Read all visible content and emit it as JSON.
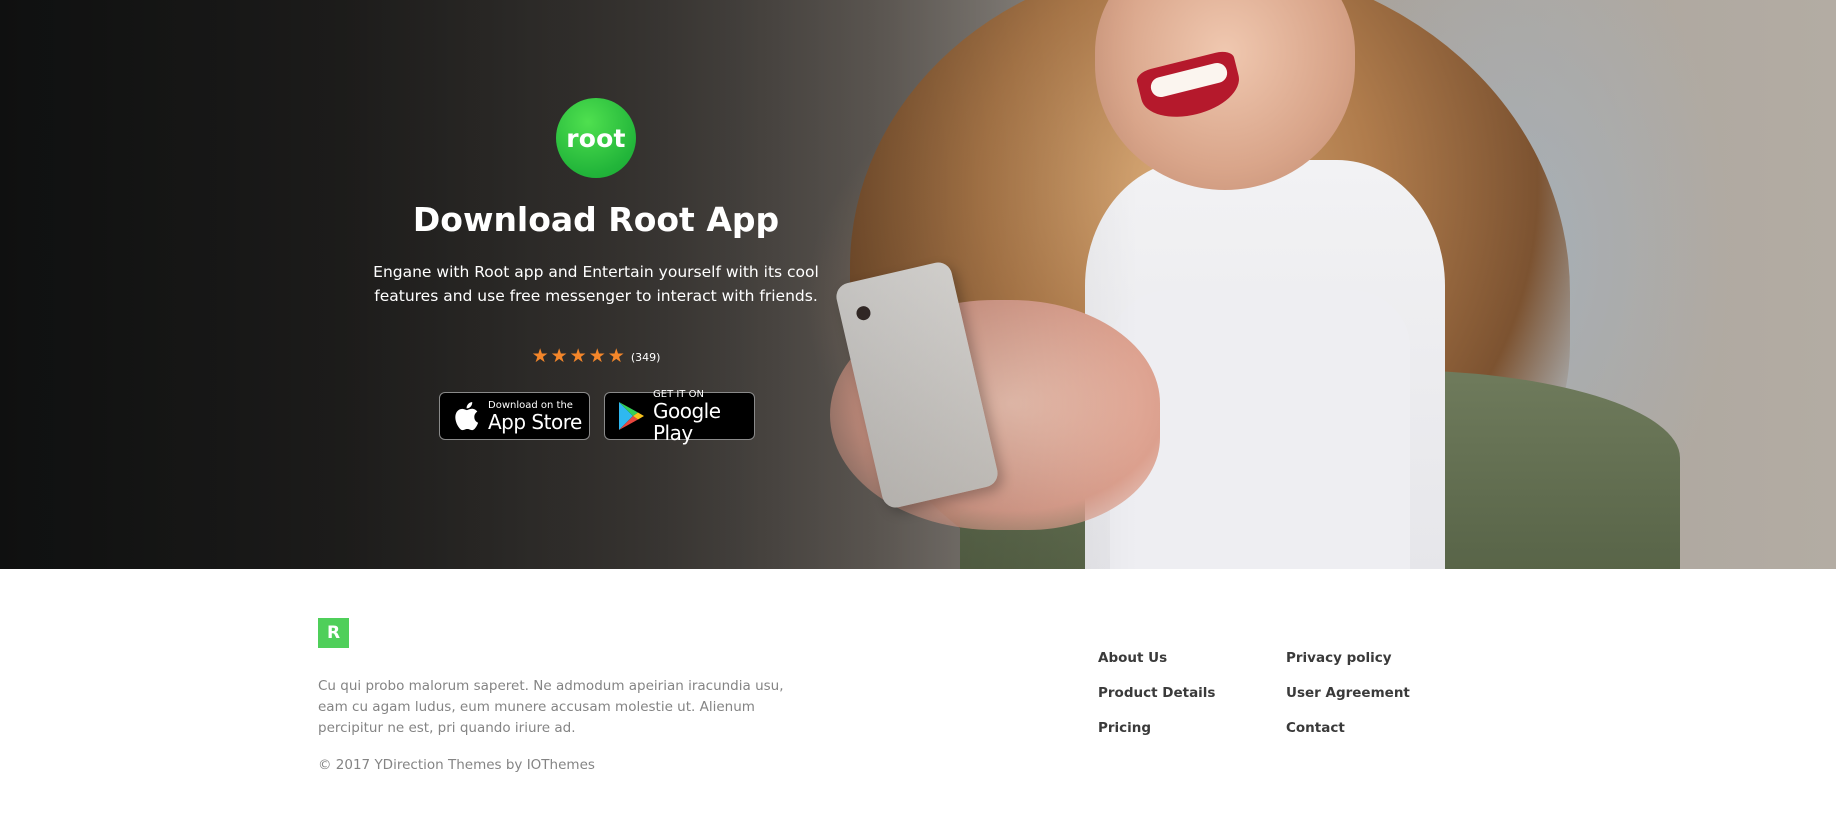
{
  "hero": {
    "logo_text": "root",
    "title": "Download Root App",
    "description": "Engane with Root app and Entertain yourself with its cool features and use free messenger to interact with friends.",
    "rating": {
      "stars": 5,
      "max_stars": 5,
      "count_label": "(349)",
      "star_color": "#f4862a"
    },
    "stores": [
      {
        "icon": "apple-icon",
        "small": "Download on the",
        "big": "App Store"
      },
      {
        "icon": "google-play-icon",
        "small": "GET IT ON",
        "big": "Google Play"
      }
    ],
    "accent_color": "#22b53a"
  },
  "footer": {
    "logo_letter": "R",
    "logo_color": "#4fcf5a",
    "description": "Cu qui probo malorum saperet. Ne admodum apeirian iracundia usu, eam cu agam ludus, eum munere accusam molestie ut. Alienum percipitur ne est, pri quando iriure ad.",
    "copyright": "© 2017 YDirection Themes by IOThemes",
    "links_col1": [
      "About Us",
      "Product Details",
      "Pricing"
    ],
    "links_col2": [
      "Privacy policy",
      "User Agreement",
      "Contact"
    ]
  }
}
